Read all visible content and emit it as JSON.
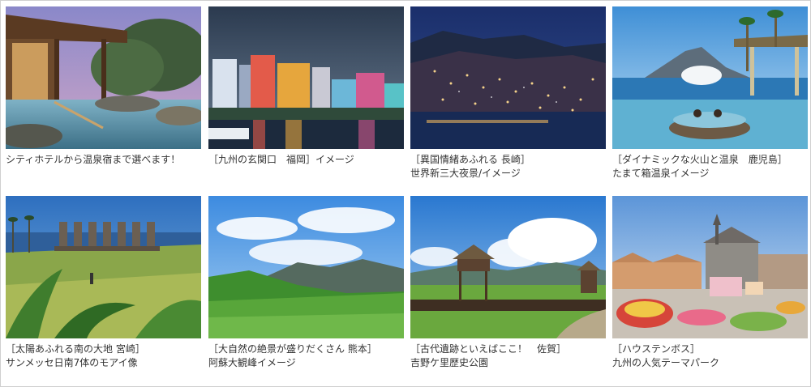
{
  "cards": [
    {
      "line1": "シティホテルから温泉宿まで選べます！",
      "line2": ""
    },
    {
      "line1": "［九州の玄関口　福岡］イメージ",
      "line2": ""
    },
    {
      "line1": "［異国情緒あふれる 長崎］",
      "line2": "世界新三大夜景/イメージ"
    },
    {
      "line1": "［ダイナミックな火山と温泉　鹿児島］",
      "line2": "たまて箱温泉イメージ"
    },
    {
      "line1": "［太陽あふれる南の大地 宮崎］",
      "line2": "サンメッセ日南7体のモアイ像"
    },
    {
      "line1": "［大自然の絶景が盛りだくさん 熊本］",
      "line2": "阿蘇大観峰イメージ"
    },
    {
      "line1": "［古代遺跡といえばここ！　佐賀］",
      "line2": "吉野ケ里歴史公園"
    },
    {
      "line1": "［ハウステンボス］",
      "line2": "九州の人気テーマパーク"
    }
  ]
}
